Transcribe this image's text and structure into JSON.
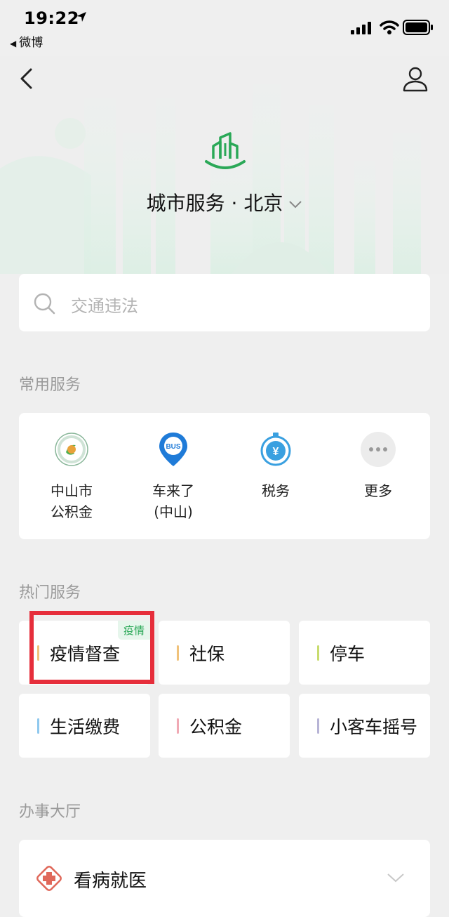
{
  "status": {
    "time": "19:22",
    "back_app": "微博"
  },
  "header": {
    "city_title": "城市服务 · 北京"
  },
  "search": {
    "placeholder": "交通违法"
  },
  "common_services": {
    "title": "常用服务",
    "items": [
      {
        "label": "中山市公积金",
        "icon": "housing-fund-logo-icon"
      },
      {
        "label": "车来了(中山)",
        "icon": "bus-pin-icon"
      },
      {
        "label": "税务",
        "icon": "tax-yen-icon"
      },
      {
        "label": "更多",
        "icon": "more-dots-icon"
      }
    ]
  },
  "hot_services": {
    "title": "热门服务",
    "items": [
      {
        "label": "疫情督查",
        "tag": "疫情",
        "accent": "#f0c27a"
      },
      {
        "label": "社保",
        "accent": "#f0c27a"
      },
      {
        "label": "停车",
        "accent": "#c8dc6e"
      },
      {
        "label": "生活缴费",
        "accent": "#8fc8ee"
      },
      {
        "label": "公积金",
        "accent": "#f0a9b4"
      },
      {
        "label": "小客车摇号",
        "accent": "#b7b4d6"
      }
    ]
  },
  "office_hall": {
    "title": "办事大厅",
    "items": [
      {
        "label": "看病就医",
        "icon": "medical-cross-icon"
      }
    ]
  },
  "colors": {
    "brand_green": "#2aa857",
    "highlight_red": "#e62e3b",
    "background": "#efefef"
  }
}
